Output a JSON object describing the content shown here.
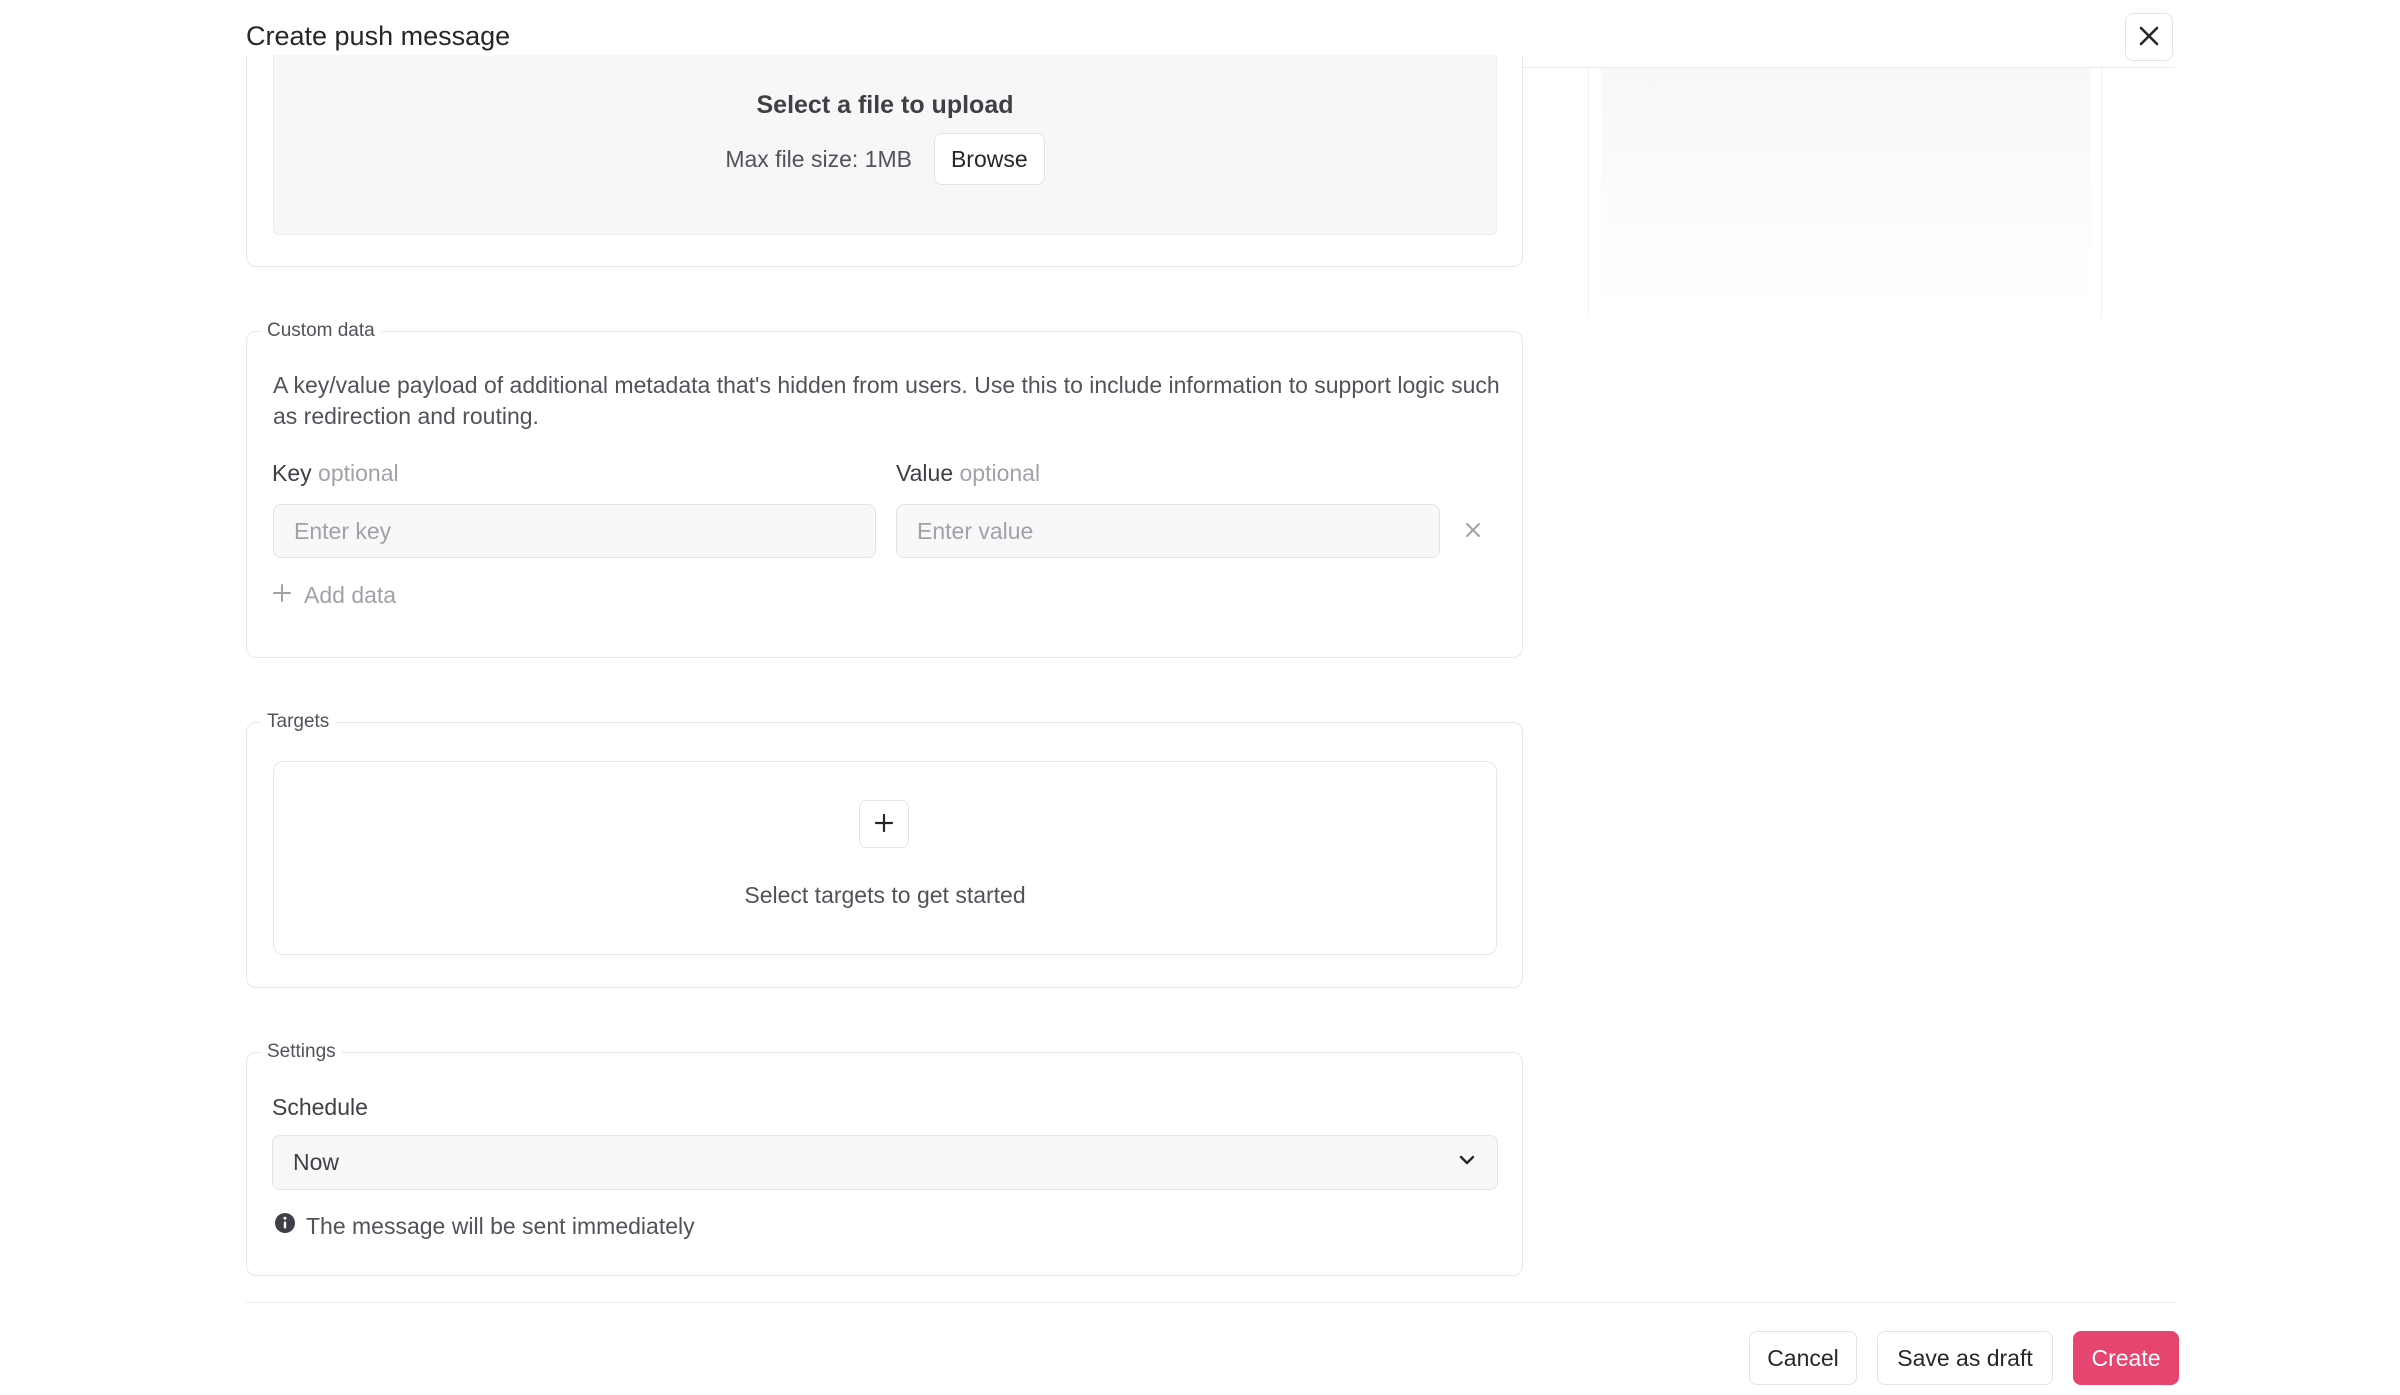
{
  "dialog": {
    "title": "Create push message"
  },
  "upload": {
    "title": "Select a file to upload",
    "hint": "Max file size: 1MB",
    "browse_label": "Browse"
  },
  "custom_data": {
    "legend": "Custom data",
    "description": "A key/value payload of additional metadata that's hidden from users. Use this to include information to support logic such as redirection and routing.",
    "key_label": "Key",
    "value_label": "Value",
    "optional_text": "optional",
    "key_value": "",
    "key_placeholder": "Enter key",
    "value_value": "",
    "value_placeholder": "Enter value",
    "add_label": "Add data"
  },
  "targets": {
    "legend": "Targets",
    "empty_text": "Select targets to get started"
  },
  "settings": {
    "legend": "Settings",
    "schedule_label": "Schedule",
    "schedule_value": "Now",
    "info_text": "The message will be sent immediately"
  },
  "footer": {
    "cancel_label": "Cancel",
    "draft_label": "Save as draft",
    "create_label": "Create"
  },
  "colors": {
    "accent": "#e5456e",
    "border": "#e4e4e7",
    "text": "#3f3f46",
    "muted": "#a1a1aa"
  },
  "icons": [
    "close-icon",
    "x-icon",
    "plus-icon",
    "chevron-down-icon",
    "info-icon"
  ]
}
